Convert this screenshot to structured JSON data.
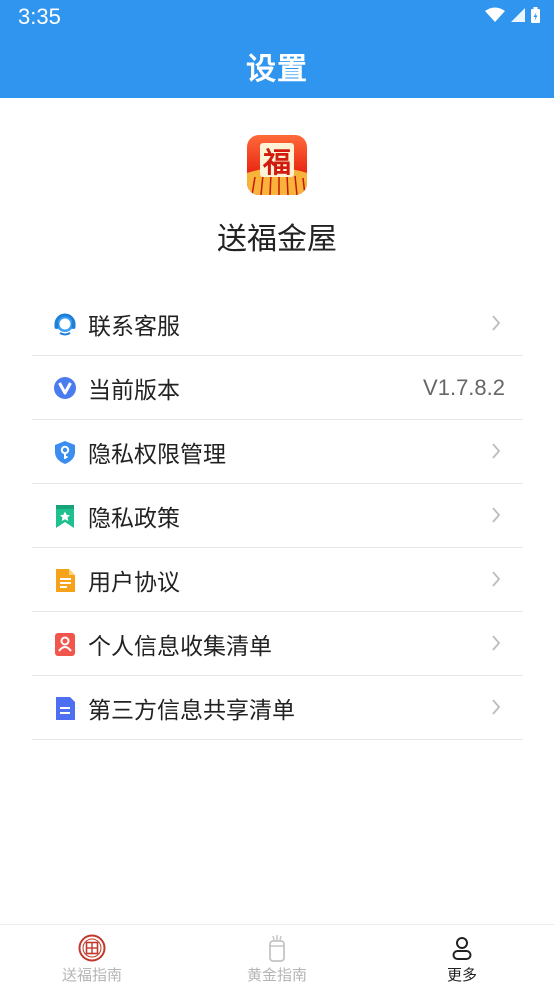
{
  "status_bar": {
    "time": "3:35"
  },
  "header": {
    "title": "设置"
  },
  "app": {
    "name": "送福金屋",
    "logo_glyph": "福"
  },
  "menu": [
    {
      "icon": "headset-icon",
      "label": "联系客服",
      "chevron": true
    },
    {
      "icon": "version-v-icon",
      "label": "当前版本",
      "value": "V1.7.8.2"
    },
    {
      "icon": "shield-key-icon",
      "label": "隐私权限管理",
      "chevron": true
    },
    {
      "icon": "bookmark-star-icon",
      "label": "隐私政策",
      "chevron": true
    },
    {
      "icon": "document-icon",
      "label": "用户协议",
      "chevron": true
    },
    {
      "icon": "person-card-icon",
      "label": "个人信息收集清单",
      "chevron": true
    },
    {
      "icon": "file-lines-icon",
      "label": "第三方信息共享清单",
      "chevron": true
    }
  ],
  "tabbar": {
    "items": [
      {
        "label": "送福指南",
        "icon": "fu-seal-icon",
        "active": false
      },
      {
        "label": "黄金指南",
        "icon": "gold-jar-icon",
        "active": false
      },
      {
        "label": "更多",
        "icon": "person-outline-icon",
        "active": true
      }
    ]
  },
  "colors": {
    "primary": "#2f95ee",
    "divider": "#e7e7e7",
    "inactive": "#b5b5b5"
  }
}
